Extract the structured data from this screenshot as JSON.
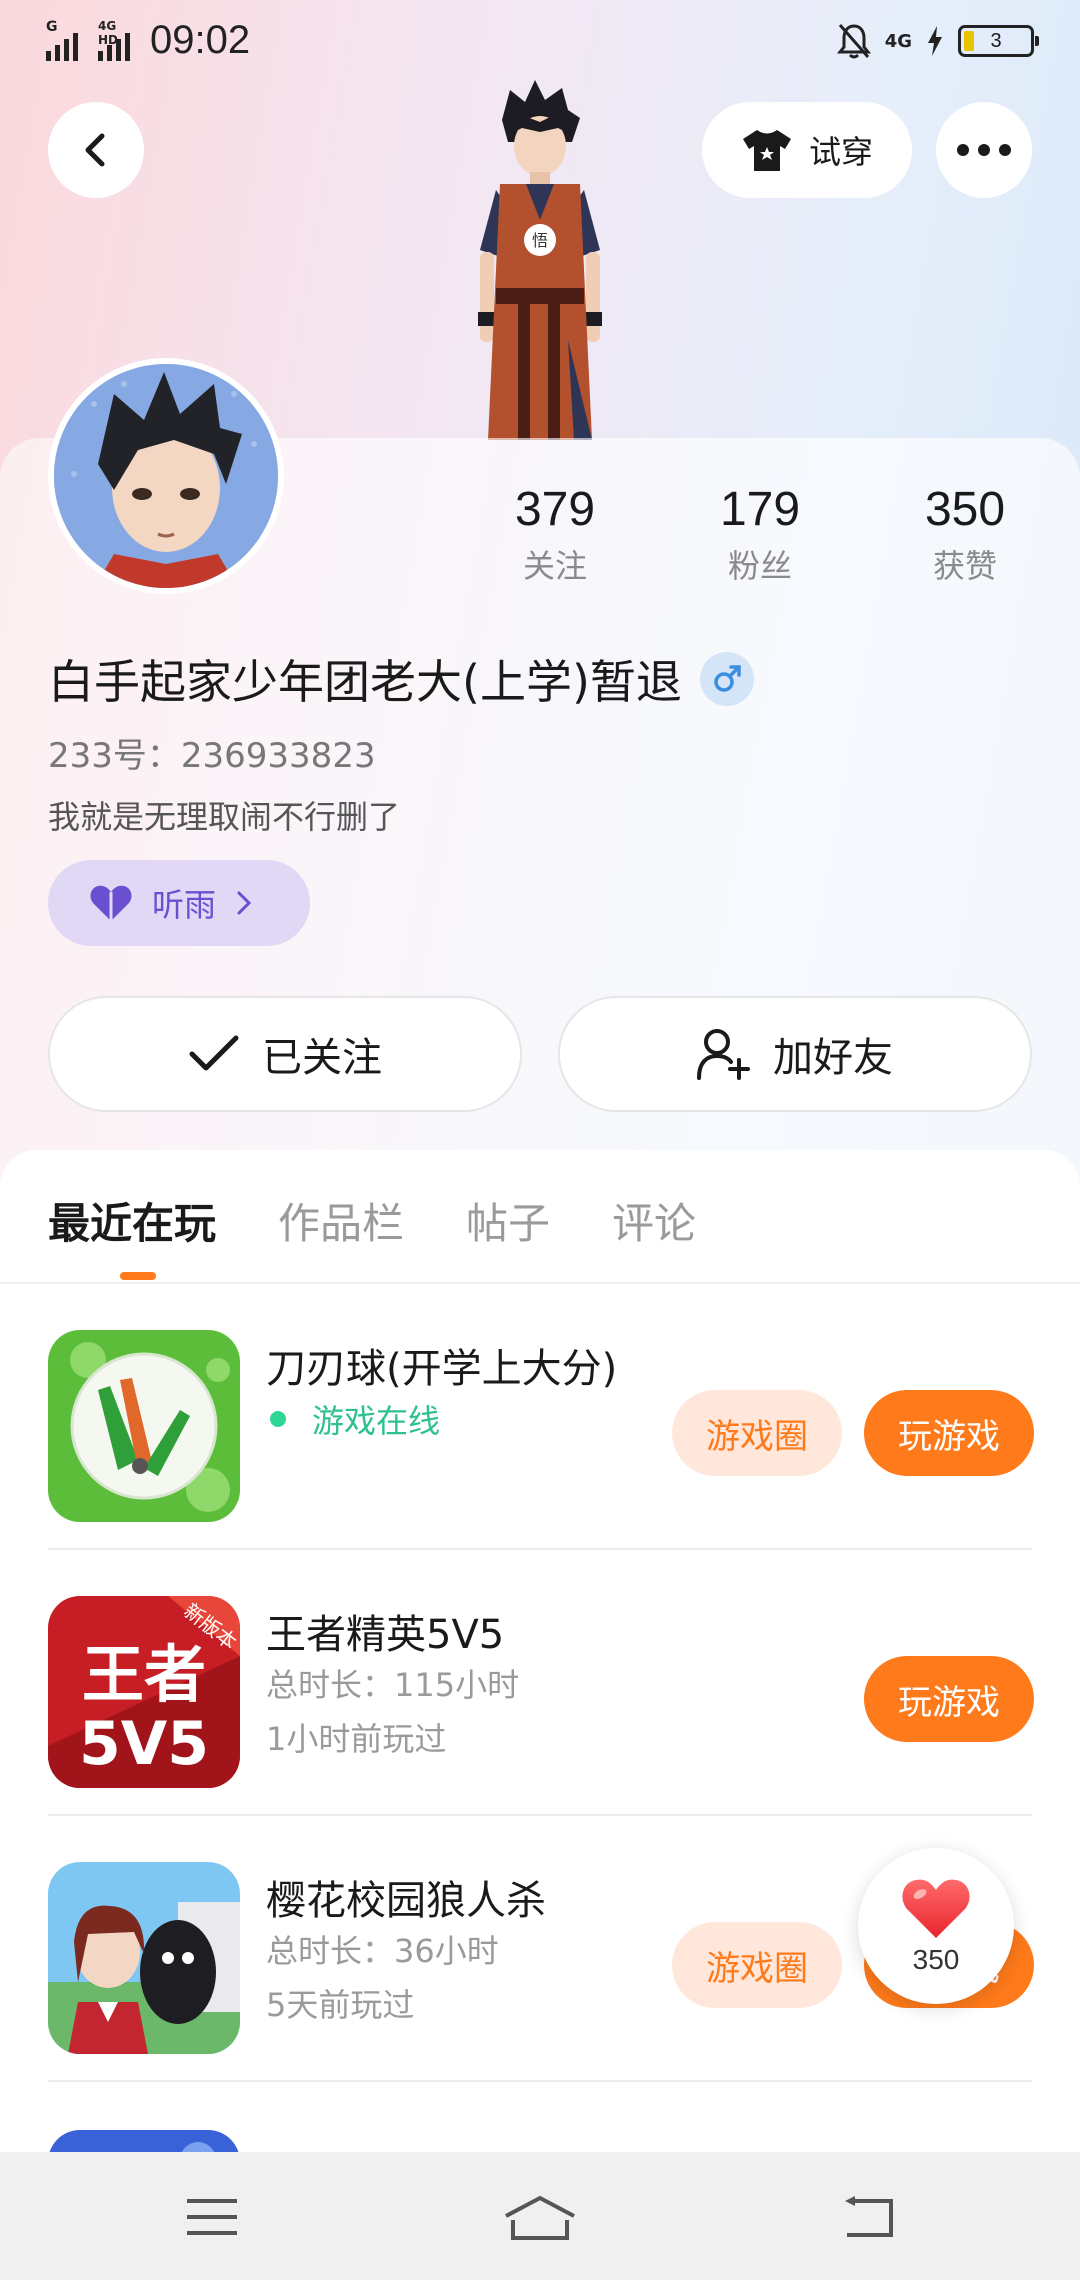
{
  "status_bar": {
    "time": "09:02",
    "signal1_tag": "G",
    "signal2_tag": "4G HD",
    "network_right": "4G",
    "battery_level": "3"
  },
  "header": {
    "tryon_label": "试穿"
  },
  "profile": {
    "stats": [
      {
        "value": "379",
        "label": "关注"
      },
      {
        "value": "179",
        "label": "粉丝"
      },
      {
        "value": "350",
        "label": "获赞"
      }
    ],
    "username": "白手起家少年团老大(上学)暂退",
    "user_id": "233号：236933823",
    "bio": "我就是无理取闹不行删了",
    "tag_label": "听雨",
    "followed_label": "已关注",
    "add_friend_label": "加好友"
  },
  "tabs": [
    {
      "label": "最近在玩",
      "active": true
    },
    {
      "label": "作品栏",
      "active": false
    },
    {
      "label": "帖子",
      "active": false
    },
    {
      "label": "评论",
      "active": false
    }
  ],
  "games": [
    {
      "name": "刀刃球(开学上大分)",
      "status": "游戏在线",
      "circle_label": "游戏圈",
      "play_label": "玩游戏"
    },
    {
      "name": "王者精英5V5",
      "duration": "总时长：115小时",
      "last_played": "1小时前玩过",
      "play_label": "玩游戏",
      "icon_text": "王者5V5",
      "icon_badge": "新版本"
    },
    {
      "name": "樱花校园狼人杀",
      "duration": "总时长：36小时",
      "last_played": "5天前玩过",
      "circle_label": "游戏圈",
      "play_label": "玩游戏"
    }
  ],
  "like_float": {
    "count": "350"
  },
  "colors": {
    "accent": "#ff7a1a",
    "accent_light": "#ffe8db",
    "online_green": "#2fc08f",
    "tag_purple": "#6a4fd0"
  }
}
